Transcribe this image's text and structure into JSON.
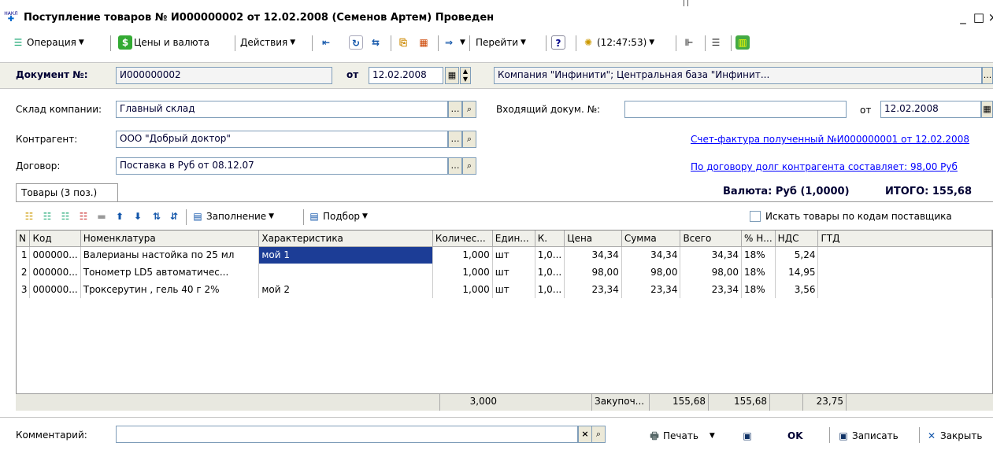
{
  "window": {
    "title": "Поступление товаров № И000000002 от 12.02.2008 (Семенов Артем) Проведен",
    "app_icon_text": "НАКЛ"
  },
  "toolbar": {
    "operation": "Операция",
    "prices_currency": "Цены и валюта",
    "actions": "Действия",
    "goto": "Перейти",
    "help": "?",
    "time": "(12:47:53)"
  },
  "docbar": {
    "number_label": "Документ №:",
    "number_value": "И000000002",
    "from_label": "от",
    "date_value": "12.02.2008",
    "org_value": "Компания \"Инфинити\"; Центральная база \"Инфинит...",
    "ellipsis": "..."
  },
  "form": {
    "warehouse_label": "Склад компании:",
    "warehouse_value": "Главный склад",
    "contractor_label": "Контрагент:",
    "contractor_value": "ООО \"Добрый доктор\"",
    "contract_label": "Договор:",
    "contract_value": "Поставка в Руб от 08.12.07",
    "incoming_label": "Входящий докум. №:",
    "incoming_value": "",
    "incoming_from_label": "от",
    "incoming_date": "12.02.2008",
    "invoice_link": "Счет-фактура полученный №И000000001 от 12.02.2008",
    "debt_link": "По договору долг контрагента составляет: 98,00 Руб",
    "currency_total": "Валюта: Руб (1,0000)",
    "total": "ИТОГО: 155,68"
  },
  "tabs": {
    "goods": "Товары (3 поз.)"
  },
  "grid_toolbar": {
    "fill": "Заполнение",
    "select": "Подбор",
    "search_by_supplier": "Искать товары по кодам поставщика"
  },
  "grid": {
    "headers": [
      "N",
      "Код",
      "Номенклатура",
      "Характеристика",
      "Количес...",
      "Един...",
      "К.",
      "Цена",
      "Сумма",
      "Всего",
      "% Н...",
      "НДС",
      "ГТД"
    ],
    "rows": [
      [
        "1",
        "000000...",
        "Валерианы настойка по 25 мл",
        "мой 1",
        "1,000",
        "шт",
        "1,0...",
        "34,34",
        "34,34",
        "34,34",
        "18%",
        "5,24",
        ""
      ],
      [
        "2",
        "000000...",
        "Тонометр LD5 автоматичес...",
        "",
        "1,000",
        "шт",
        "1,0...",
        "98,00",
        "98,00",
        "98,00",
        "18%",
        "14,95",
        ""
      ],
      [
        "3",
        "000000...",
        "Троксерутин , гель 40 г 2%",
        "мой 2",
        "1,000",
        "шт",
        "1,0...",
        "23,34",
        "23,34",
        "23,34",
        "18%",
        "3,56",
        ""
      ]
    ],
    "footer": {
      "qty": "3,000",
      "price_type": "Закупоч...",
      "sum": "155,68",
      "total": "155,68",
      "vat": "23,75"
    }
  },
  "bottom": {
    "comment_label": "Комментарий:",
    "comment_value": "",
    "print": "Печать",
    "ok": "OK",
    "save": "Записать",
    "close": "Закрыть"
  }
}
